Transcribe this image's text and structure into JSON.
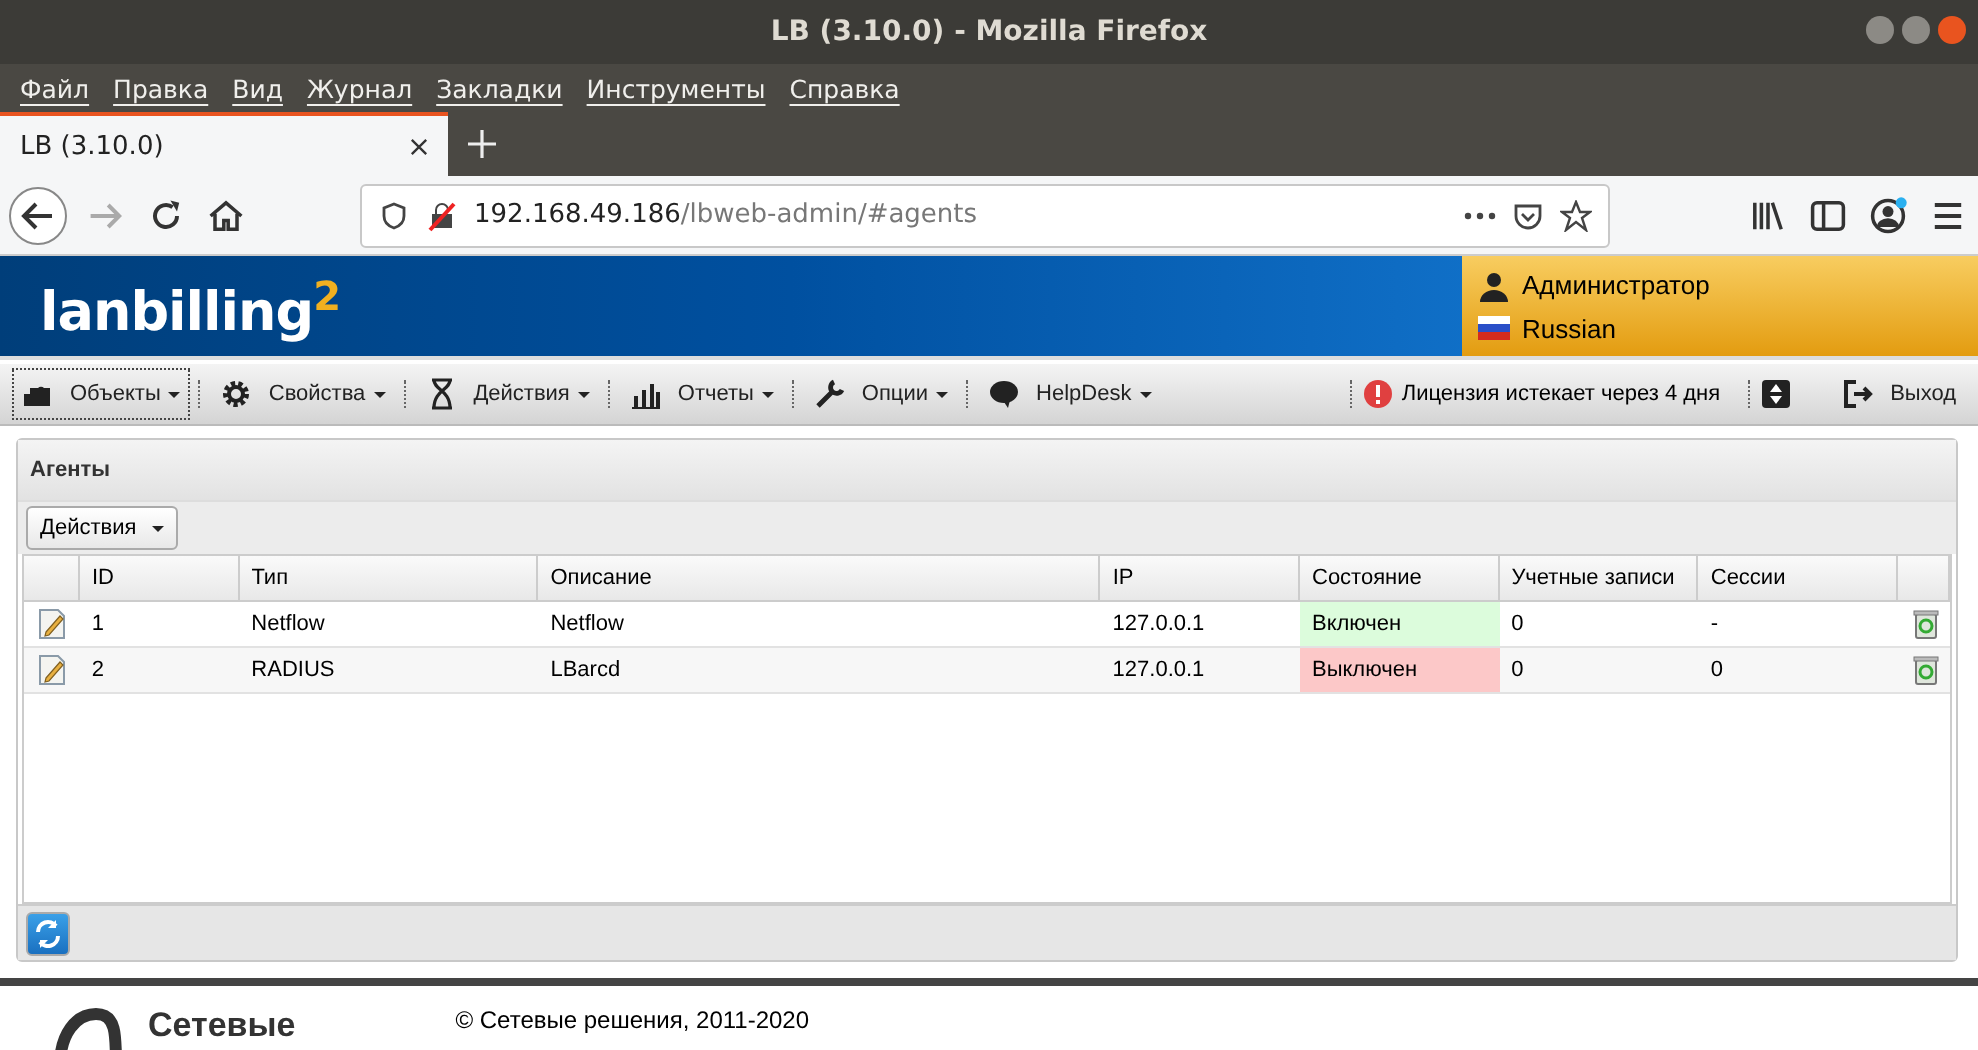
{
  "window": {
    "title": "LB (3.10.0) - Mozilla Firefox"
  },
  "menu": [
    "Файл",
    "Правка",
    "Вид",
    "Журнал",
    "Закладки",
    "Инструменты",
    "Справка"
  ],
  "tabs": [
    {
      "label": "LB (3.10.0)",
      "selected": true
    }
  ],
  "address": {
    "host": "192.168.49.186",
    "path": "/lbweb-admin/#agents"
  },
  "header": {
    "logo": "lanbilling",
    "logo_sup": "2",
    "user": "Администратор",
    "language": "Russian"
  },
  "toolbar": [
    {
      "label": "Объекты",
      "selected": true
    },
    {
      "label": "Свойства",
      "selected": false
    },
    {
      "label": "Действия",
      "selected": false
    },
    {
      "label": "Отчеты",
      "selected": false
    },
    {
      "label": "Опции",
      "selected": false
    },
    {
      "label": "HelpDesk",
      "selected": false
    }
  ],
  "license_warning": "Лицензия истекает через 4 дня",
  "logout": "Выход",
  "panel": {
    "title": "Агенты",
    "actions_button": "Действия",
    "table": {
      "columns": [
        "ID",
        "Тип",
        "Описание",
        "IP",
        "Состояние",
        "Учетные записи",
        "Сессии"
      ],
      "rows": [
        {
          "id": "1",
          "type": "Netflow",
          "description": "Netflow",
          "ip": "127.0.0.1",
          "state": "Включен",
          "enabled": true,
          "accounts": "0",
          "sessions": "-"
        },
        {
          "id": "2",
          "type": "RADIUS",
          "description": "LBarcd",
          "ip": "127.0.0.1",
          "state": "Выключен",
          "enabled": false,
          "accounts": "0",
          "sessions": "0"
        }
      ]
    }
  },
  "footer": {
    "company": "Сетевые",
    "copyright": "© Сетевые решения, 2011-2020"
  }
}
